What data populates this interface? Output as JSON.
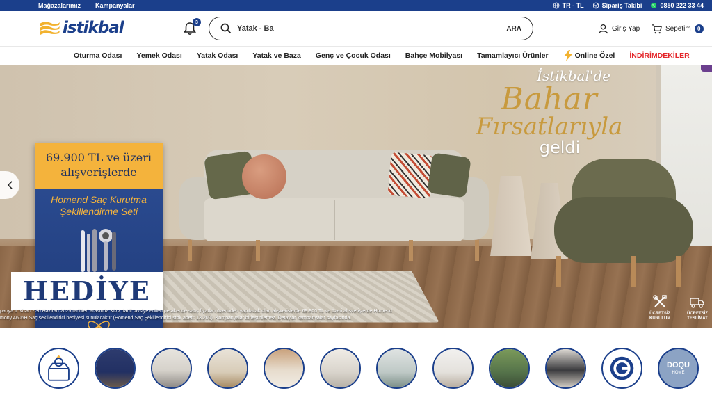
{
  "topbar": {
    "stores": "Mağazalarımız",
    "campaigns": "Kampanyalar",
    "lang": "TR - TL",
    "order_tracking": "Sipariş Takibi",
    "phone": "0850 222 33 44"
  },
  "header": {
    "logo_text": "istikbal",
    "notification_count": "3",
    "search_value": "Yatak - Ba",
    "search_button": "ARA",
    "login": "Giriş Yap",
    "cart": "Sepetim",
    "cart_count": "0"
  },
  "nav": {
    "items": [
      "Oturma Odası",
      "Yemek Odası",
      "Yatak Odası",
      "Yatak ve Baza",
      "Genç ve Çocuk Odası",
      "Bahçe Mobilyası",
      "Tamamlayıcı Ürünler",
      "Online Özel",
      "İNDİRİMDEKİLER"
    ]
  },
  "hero": {
    "title_line1": "İstikbal'de",
    "title_line2": "Bahar",
    "title_line3": "Fırsatlarıyla",
    "title_line4": "geldi",
    "promo_top_line1": "69.900 TL ve üzeri",
    "promo_top_line2": "alışverişlerde",
    "promo_sub_line1": "Homend Saç Kurutma",
    "promo_sub_line2": "Şekillendirme Seti",
    "promo_hediye": "HEDİYE",
    "disclaimer_line1": "panya 1 Nisan - 30 Haziran 2025 tarihleri arasında KDV dahil tavsiye edilen perakende satış fiyatları üzerinden yapılacak olan alışverişlerde 69.900 TL ve üzeri alışverişlerde Homend",
    "disclaimer_line2": "mony 4606H Saç şekillendirici hediyesi sunulacaktır (Homend Saç Şekillendirici stok adeti: 13.200). Kampanyalar birleştirilemez. Detaylar kampanyalar sayfasında.",
    "feature1_line1": "ÜCRETSİZ",
    "feature1_line2": "KURULUM",
    "feature2_line1": "ÜCRETSİZ",
    "feature2_line2": "TESLİMAT"
  },
  "categories": {
    "doqu_label": "DOQU",
    "doqu_sub": "HOME"
  },
  "colors": {
    "brand_blue": "#1b3f8b",
    "accent_red": "#e4262a",
    "gold": "#f4b33c"
  }
}
